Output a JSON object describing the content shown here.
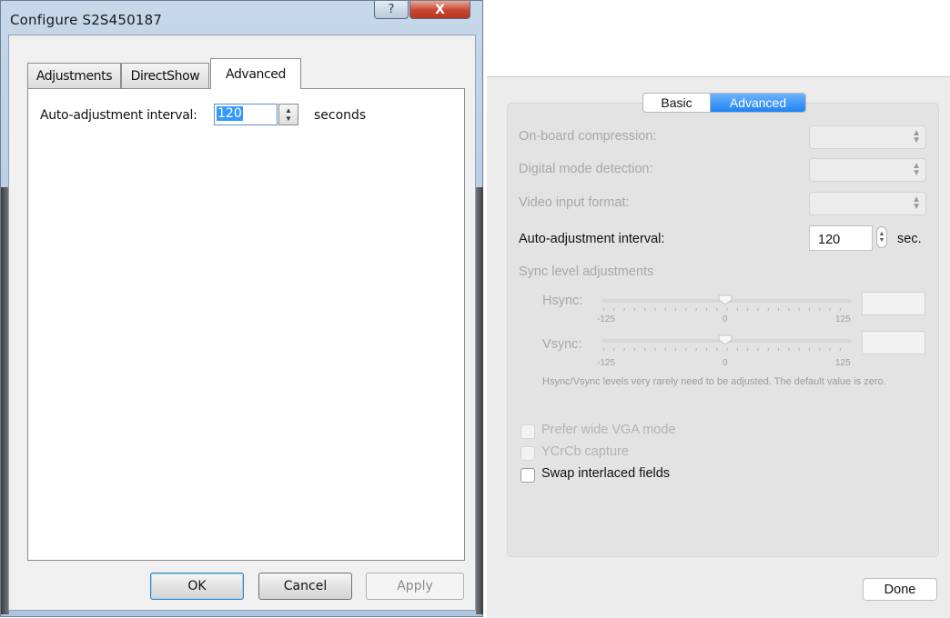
{
  "windows_dialog": {
    "title": "Configure S2S450187",
    "help_glyph": "?",
    "close_glyph": "X",
    "tabs": [
      {
        "label": "Adjustments",
        "selected": false
      },
      {
        "label": "DirectShow",
        "selected": false
      },
      {
        "label": "Advanced",
        "selected": true
      }
    ],
    "interval": {
      "label": "Auto-adjustment interval:",
      "value": "120",
      "unit": "seconds"
    },
    "buttons": {
      "ok": "OK",
      "cancel": "Cancel",
      "apply": "Apply"
    }
  },
  "mac_panel": {
    "segments": [
      {
        "label": "Basic",
        "selected": false
      },
      {
        "label": "Advanced",
        "selected": true
      }
    ],
    "rows": {
      "compression_label": "On-board compression:",
      "digital_mode_label": "Digital mode detection:",
      "video_input_label": "Video input format:",
      "interval_label": "Auto-adjustment interval:",
      "interval_value": "120",
      "interval_unit": "sec."
    },
    "sync": {
      "heading": "Sync level adjustments",
      "hsync_label": "Hsync:",
      "vsync_label": "Vsync:",
      "min_label": "-125",
      "mid_label": "0",
      "max_label": "125",
      "hsync_value": 0,
      "vsync_value": 0,
      "note": "Hsync/Vsync levels very rarely need to be adjusted. The default value is zero."
    },
    "checkboxes": [
      {
        "label": "Prefer wide VGA mode",
        "checked": false,
        "enabled": false
      },
      {
        "label": "YCrCb capture",
        "checked": false,
        "enabled": false
      },
      {
        "label": "Swap interlaced fields",
        "checked": false,
        "enabled": true
      }
    ],
    "done_label": "Done"
  },
  "colors": {
    "selection_blue": "#3399ff",
    "mac_accent": "#1f83f5",
    "close_red": "#c8452f"
  }
}
